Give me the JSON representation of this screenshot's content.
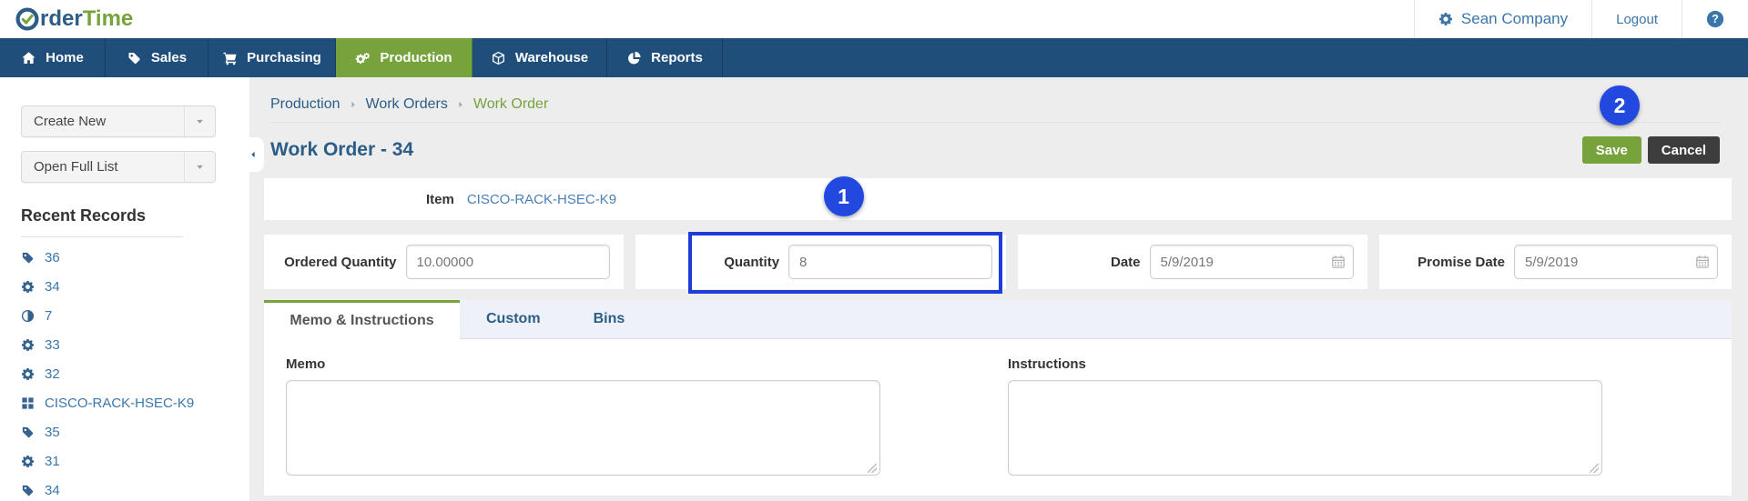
{
  "brand": {
    "name_rest": "rder",
    "name_accent": "Time"
  },
  "header": {
    "company": "Sean Company",
    "logout_label": "Logout"
  },
  "nav": {
    "items": [
      {
        "label": "Home",
        "icon": "home",
        "active": false
      },
      {
        "label": "Sales",
        "icon": "tag",
        "active": false
      },
      {
        "label": "Purchasing",
        "icon": "cart",
        "active": false
      },
      {
        "label": "Production",
        "icon": "cogs",
        "active": true
      },
      {
        "label": "Warehouse",
        "icon": "cube",
        "active": false
      },
      {
        "label": "Reports",
        "icon": "pie",
        "active": false
      }
    ]
  },
  "sidebar": {
    "create_new_label": "Create New",
    "open_full_list_label": "Open Full List",
    "recent_records_title": "Recent Records",
    "recent_records": [
      {
        "label": "36",
        "icon": "tag"
      },
      {
        "label": "34",
        "icon": "gear"
      },
      {
        "label": "7",
        "icon": "adjust"
      },
      {
        "label": "33",
        "icon": "gear"
      },
      {
        "label": "32",
        "icon": "gear"
      },
      {
        "label": "CISCO-RACK-HSEC-K9",
        "icon": "grid"
      },
      {
        "label": "35",
        "icon": "tag"
      },
      {
        "label": "31",
        "icon": "gear"
      },
      {
        "label": "34",
        "icon": "tag"
      }
    ]
  },
  "breadcrumb": {
    "items": [
      "Production",
      "Work Orders",
      "Work Order"
    ]
  },
  "page": {
    "title": "Work Order - 34"
  },
  "actions": {
    "save_label": "Save",
    "cancel_label": "Cancel"
  },
  "annotations": {
    "step1": "1",
    "step2": "2"
  },
  "item_row": {
    "label": "Item",
    "value": "CISCO-RACK-HSEC-K9"
  },
  "fields": {
    "ordered_quantity": {
      "label": "Ordered Quantity",
      "value": "10.00000"
    },
    "quantity": {
      "label": "Quantity",
      "value": "8"
    },
    "date": {
      "label": "Date",
      "value": "5/9/2019"
    },
    "promise_date": {
      "label": "Promise Date",
      "value": "5/9/2019"
    }
  },
  "tabs": {
    "items": [
      {
        "label": "Memo & Instructions",
        "active": true
      },
      {
        "label": "Custom",
        "active": false
      },
      {
        "label": "Bins",
        "active": false
      }
    ]
  },
  "memo_tab": {
    "memo_label": "Memo",
    "memo_value": "",
    "instructions_label": "Instructions",
    "instructions_value": ""
  },
  "colors": {
    "navbar_blue": "#1f4e7b",
    "accent_green": "#76a33c",
    "link_blue": "#3b76ab",
    "title_blue": "#2b5d87",
    "annotation_blue": "#2149e0",
    "highlight_border_blue": "#1e3cd8",
    "save_green": "#76a33c",
    "cancel_dark": "#3d3d3d",
    "content_bg": "#ededed",
    "tabbar_bg": "#eef1f8"
  }
}
